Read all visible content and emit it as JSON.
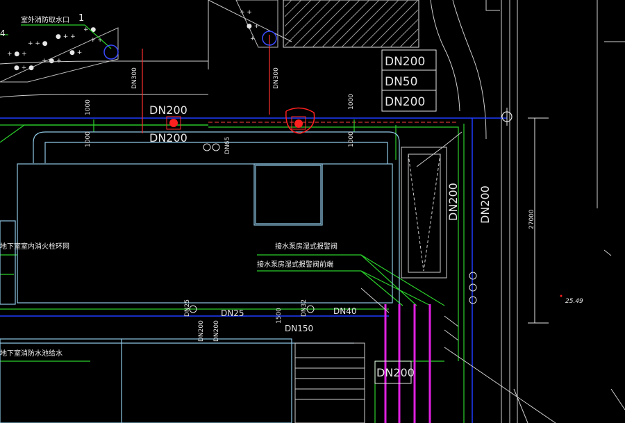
{
  "drawing": {
    "labels": {
      "outdoor_hydrant": "室外消防取水口",
      "num1": "1",
      "num4": "4",
      "dn300_a": "DN300",
      "dn300_b": "DN300",
      "box_dn200_1": "DN200",
      "box_dn50": "DN50",
      "box_dn200_2": "DN200",
      "dn200_top": "DN200",
      "dn200_under": "DN200",
      "dim1000_a": "1000",
      "dim1000_b": "1000",
      "dim1000_c": "1000",
      "dim1000_d": "1000",
      "dn65": "DN65",
      "dn200_vert_a": "DN200",
      "dn200_vert_b": "DN200",
      "dim27000": "27000",
      "elev": "25.49",
      "indoor_ring": "地下室室内消火栓环网",
      "alarm1": "接水泵房湿式报警阀",
      "alarm2": "接水泵房湿式报警阀前端",
      "dn25a": "DN25",
      "dn25b": "DN25",
      "dn32": "DN32",
      "dn40": "DN40",
      "dim1500": "1500",
      "dn150": "DN150",
      "dn200_low_a": "DN200",
      "dn200_low_b": "DN200",
      "pool_supply": "地下室消防水池给水",
      "dn200_box_bottom": "DN200"
    },
    "colors": {
      "background": "#000000",
      "green": "#2bd02b",
      "blue": "#1f3cff",
      "cyan": "#8fc8e6",
      "magenta": "#e020e0",
      "red": "#ff2020",
      "white": "#e6e6e6"
    }
  }
}
